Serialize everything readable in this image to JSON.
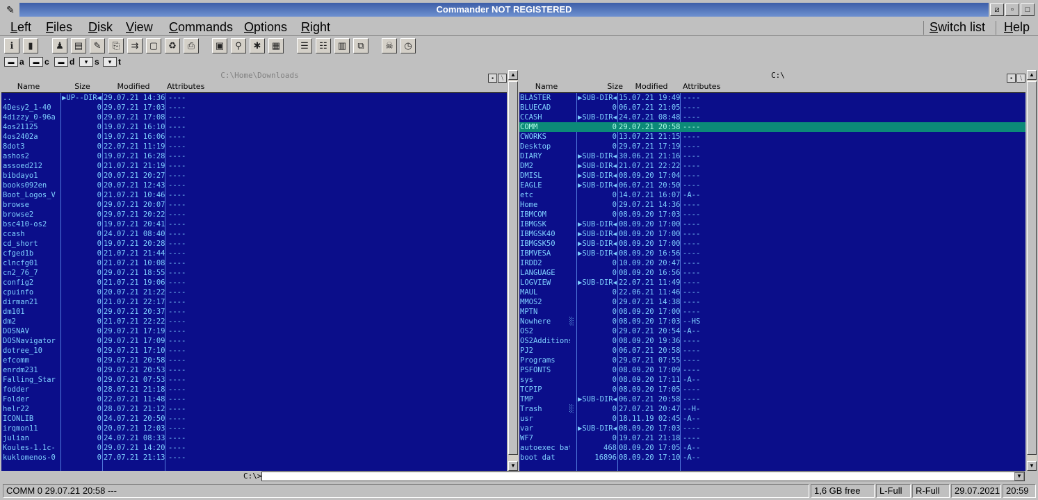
{
  "window": {
    "title": "Commander NOT REGISTERED"
  },
  "menu": {
    "items": [
      "Left",
      "Files",
      "Disk",
      "View",
      "Commands",
      "Options",
      "Right"
    ],
    "switch_list": "Switch list",
    "help": "Help"
  },
  "toolbar": {
    "icons": [
      "info-icon",
      "exit-door-icon",
      "user-icon",
      "book-icon",
      "edit-icon",
      "copy-icon",
      "move-icon",
      "new-file-icon",
      "delete-icon",
      "print-icon",
      "save-disk-icon",
      "find-icon",
      "mark-icon",
      "archive-icon",
      "tree-left-icon",
      "tree-right-icon",
      "calendar-icon",
      "compare-icon",
      "skull-icon",
      "clock-icon"
    ],
    "glyphs": [
      "ℹ",
      "▮",
      "♟",
      "▤",
      "✎",
      "⎘",
      "⇉",
      "▢",
      "♻",
      "⎙",
      "▣",
      "⚲",
      "✱",
      "▦",
      "☰",
      "☷",
      "▥",
      "⧉",
      "☠",
      "◷"
    ]
  },
  "drives": [
    {
      "letter": "a",
      "icon": "floppy-drive-icon",
      "glyph": "▬"
    },
    {
      "letter": "c",
      "icon": "hard-drive-icon",
      "glyph": "▬"
    },
    {
      "letter": "d",
      "icon": "hard-drive-icon",
      "glyph": "▬"
    },
    {
      "letter": "s",
      "icon": "network-drive-icon",
      "glyph": "▾"
    },
    {
      "letter": "t",
      "icon": "network-drive-icon",
      "glyph": "▾"
    }
  ],
  "left_panel": {
    "path": "C:\\Home\\Downloads",
    "columns": [
      "Name",
      "Size",
      "Modified",
      "Attributes"
    ],
    "rows": [
      [
        "..",
        "▶UP--DIR◀",
        "29.07.21 14:36",
        "----"
      ],
      [
        "4Desy2_1-40",
        "0",
        "29.07.21 17:03",
        "----"
      ],
      [
        "4dizzy_0-96a",
        "0",
        "29.07.21 17:08",
        "----"
      ],
      [
        "4os21125",
        "0",
        "19.07.21 16:10",
        "----"
      ],
      [
        "4os2402a",
        "0",
        "19.07.21 16:06",
        "----"
      ],
      [
        "8dot3",
        "0",
        "22.07.21 11:19",
        "----"
      ],
      [
        "ashos2",
        "0",
        "19.07.21 16:28",
        "----"
      ],
      [
        "assoed212",
        "0",
        "21.07.21 21:19",
        "----"
      ],
      [
        "bibdayo1",
        "0",
        "20.07.21 20:27",
        "----"
      ],
      [
        "books092en",
        "0",
        "20.07.21 12:43",
        "----"
      ],
      [
        "Boot_Logos_V",
        "0",
        "21.07.21 10:46",
        "----"
      ],
      [
        "browse",
        "0",
        "29.07.21 20:07",
        "----"
      ],
      [
        "browse2",
        "0",
        "29.07.21 20:22",
        "----"
      ],
      [
        "bsc410-os2",
        "0",
        "19.07.21 20:41",
        "----"
      ],
      [
        "ccash",
        "0",
        "24.07.21 08:40",
        "----"
      ],
      [
        "cd_short",
        "0",
        "19.07.21 20:28",
        "----"
      ],
      [
        "cfged1b",
        "0",
        "21.07.21 21:44",
        "----"
      ],
      [
        "clncfg01",
        "0",
        "21.07.21 10:08",
        "----"
      ],
      [
        "cn2_76_7",
        "0",
        "29.07.21 18:55",
        "----"
      ],
      [
        "config2",
        "0",
        "21.07.21 19:06",
        "----"
      ],
      [
        "cpuinfo",
        "0",
        "20.07.21 21:22",
        "----"
      ],
      [
        "dirman21",
        "0",
        "21.07.21 22:17",
        "----"
      ],
      [
        "dm101",
        "0",
        "29.07.21 20:37",
        "----"
      ],
      [
        "dm2",
        "0",
        "21.07.21 22:22",
        "----"
      ],
      [
        "DOSNAV",
        "0",
        "29.07.21 17:19",
        "----"
      ],
      [
        "DOSNavigator",
        "0",
        "29.07.21 17:09",
        "----"
      ],
      [
        "dotree_10",
        "0",
        "29.07.21 17:10",
        "----"
      ],
      [
        "efcomm",
        "0",
        "29.07.21 20:58",
        "----"
      ],
      [
        "enrdm231",
        "0",
        "29.07.21 20:53",
        "----"
      ],
      [
        "Falling_Star",
        "0",
        "29.07.21 07:53",
        "----"
      ],
      [
        "fodder",
        "0",
        "28.07.21 21:18",
        "----"
      ],
      [
        "Folder",
        "0",
        "22.07.21 11:48",
        "----"
      ],
      [
        "helr22",
        "0",
        "28.07.21 21:12",
        "----"
      ],
      [
        "ICONLIB",
        "0",
        "24.07.21 20:50",
        "----"
      ],
      [
        "irqmon11",
        "0",
        "20.07.21 12:03",
        "----"
      ],
      [
        "julian",
        "0",
        "24.07.21 08:33",
        "----"
      ],
      [
        "Koules-1.1c-",
        "0",
        "29.07.21 14:20",
        "----"
      ],
      [
        "kuklomenos-0",
        "0",
        "27.07.21 21:13",
        "----"
      ]
    ]
  },
  "right_panel": {
    "path": "C:\\",
    "columns": [
      "Name",
      "Size",
      "Modified",
      "Attributes"
    ],
    "selected_index": 3,
    "rows": [
      [
        "BLASTER",
        "",
        "▶SUB-DIR◀",
        "15.07.21 19:49",
        "----"
      ],
      [
        "BLUECAD",
        "",
        "0",
        "06.07.21 21:05",
        "----"
      ],
      [
        "CCASH",
        "",
        "▶SUB-DIR◀",
        "24.07.21 08:48",
        "----"
      ],
      [
        "COMM",
        "",
        "0",
        "29.07.21 20:58",
        "----"
      ],
      [
        "CWORKS",
        "",
        "0",
        "13.07.21 21:15",
        "----"
      ],
      [
        "Desktop",
        "",
        "0",
        "29.07.21 17:19",
        "----"
      ],
      [
        "DIARY",
        "",
        "▶SUB-DIR◀",
        "30.06.21 21:16",
        "----"
      ],
      [
        "DM2",
        "",
        "▶SUB-DIR◀",
        "21.07.21 22:22",
        "----"
      ],
      [
        "DMISL",
        "",
        "▶SUB-DIR◀",
        "08.09.20 17:04",
        "----"
      ],
      [
        "EAGLE",
        "",
        "▶SUB-DIR◀",
        "06.07.21 20:50",
        "----"
      ],
      [
        "etc",
        "",
        "0",
        "14.07.21 16:07",
        "-A--"
      ],
      [
        "Home",
        "",
        "0",
        "29.07.21 14:36",
        "----"
      ],
      [
        "IBMCOM",
        "",
        "0",
        "08.09.20 17:03",
        "----"
      ],
      [
        "IBMGSK",
        "",
        "▶SUB-DIR◀",
        "08.09.20 17:00",
        "----"
      ],
      [
        "IBMGSK40",
        "",
        "▶SUB-DIR◀",
        "08.09.20 17:00",
        "----"
      ],
      [
        "IBMGSK50",
        "",
        "▶SUB-DIR◀",
        "08.09.20 17:00",
        "----"
      ],
      [
        "IBMVESA",
        "",
        "▶SUB-DIR◀",
        "08.09.20 16:56",
        "----"
      ],
      [
        "IRDD2",
        "",
        "0",
        "10.09.20 20:47",
        "----"
      ],
      [
        "LANGUAGE",
        "",
        "0",
        "08.09.20 16:56",
        "----"
      ],
      [
        "LOGVIEW",
        "",
        "▶SUB-DIR◀",
        "22.07.21 11:49",
        "----"
      ],
      [
        "MAUL",
        "",
        "0",
        "22.06.21 11:46",
        "----"
      ],
      [
        "MMOS2",
        "",
        "0",
        "29.07.21 14:38",
        "----"
      ],
      [
        "MPTN",
        "",
        "0",
        "08.09.20 17:00",
        "----"
      ],
      [
        "Nowhere",
        "░",
        "0",
        "08.09.20 17:03",
        "--HS"
      ],
      [
        "OS2",
        "",
        "0",
        "29.07.21 20:54",
        "-A--"
      ],
      [
        "OS2Additions",
        "",
        "0",
        "08.09.20 19:36",
        "----"
      ],
      [
        "PJ2",
        "",
        "0",
        "06.07.21 20:58",
        "----"
      ],
      [
        "Programs",
        "",
        "0",
        "29.07.21 07:55",
        "----"
      ],
      [
        "PSFONTS",
        "",
        "0",
        "08.09.20 17:09",
        "----"
      ],
      [
        "sys",
        "",
        "0",
        "08.09.20 17:11",
        "-A--"
      ],
      [
        "TCPIP",
        "",
        "0",
        "08.09.20 17:05",
        "----"
      ],
      [
        "TMP",
        "",
        "▶SUB-DIR◀",
        "06.07.21 20:58",
        "----"
      ],
      [
        "Trash",
        "░",
        "0",
        "27.07.21 20:47",
        "--H-"
      ],
      [
        "usr",
        "",
        "0",
        "18.11.19 02:45",
        "-A--"
      ],
      [
        "var",
        "",
        "▶SUB-DIR◀",
        "08.09.20 17:03",
        "----"
      ],
      [
        "WF7",
        "",
        "0",
        "19.07.21 21:18",
        "----"
      ],
      [
        "autoexec bat",
        "",
        "468",
        "08.09.20 17:05",
        "-A--"
      ],
      [
        "boot     dat",
        "",
        "16896",
        "08.09.20 17:10",
        "-A--"
      ]
    ]
  },
  "command_line": {
    "prompt": "C:\\>",
    "value": ""
  },
  "status": {
    "file_info": "COMM   0  29.07.21 20:58  ---",
    "free": "1,6 GB free",
    "left_mode": "L-Full",
    "right_mode": "R-Full",
    "date": "29.07.2021",
    "time": "20:59"
  }
}
